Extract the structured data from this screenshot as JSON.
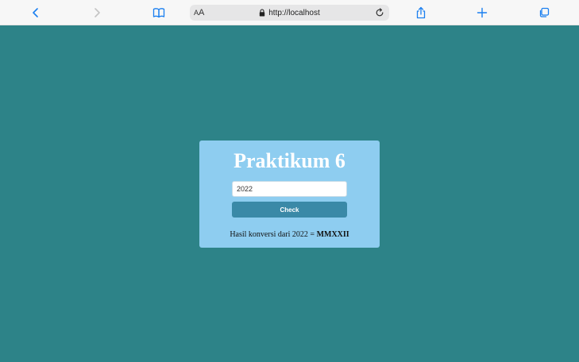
{
  "browser": {
    "aa_small": "A",
    "aa_big": "A",
    "url": "http://localhost",
    "icons": {
      "back": "chevron-left-icon",
      "forward": "chevron-right-icon",
      "bookmarks": "book-icon",
      "lock": "lock-icon",
      "reload": "reload-icon",
      "share": "share-icon",
      "new_tab": "plus-icon",
      "tabs": "tabs-icon"
    },
    "accent_color": "#1a7ff0"
  },
  "page": {
    "background_color": "#2d8388",
    "card_color": "#8ecdf0",
    "title": "Praktikum 6",
    "input_value": "2022",
    "check_label": "Check",
    "result_prefix": "Hasil konversi dari 2022 =",
    "result_value": "MMXXII"
  }
}
